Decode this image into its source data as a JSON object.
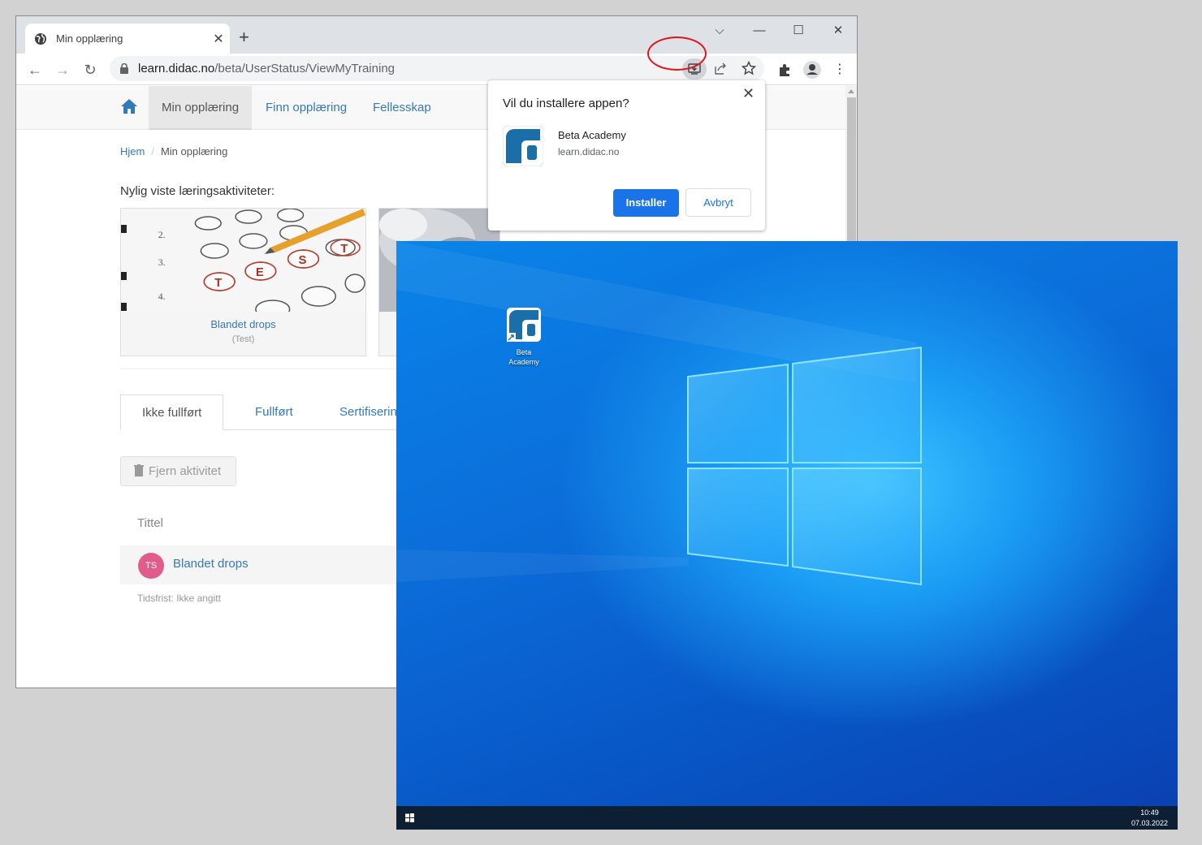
{
  "browser": {
    "tab_title": "Min opplæring",
    "url_host": "learn.didac.no",
    "url_path": "/beta/UserStatus/ViewMyTraining"
  },
  "site": {
    "nav": [
      {
        "label": "Min opplæring"
      },
      {
        "label": "Finn opplæring"
      },
      {
        "label": "Fellesskap"
      }
    ],
    "breadcrumb": {
      "home": "Hjem",
      "current": "Min opplæring"
    },
    "recent_heading": "Nylig viste læringsaktiviteter:",
    "cards": [
      {
        "title": "Blandet drops",
        "subtitle": "(Test)"
      }
    ],
    "tabs": [
      {
        "label": "Ikke fullført"
      },
      {
        "label": "Fullført"
      },
      {
        "label": "Sertifiserin"
      }
    ],
    "remove_label": "Fjern aktivitet",
    "table_header": "Tittel",
    "row": {
      "avatar": "TS",
      "title": "Blandet drops"
    },
    "deadline": "Tidsfrist: Ikke angitt"
  },
  "popup": {
    "title": "Vil du installere appen?",
    "app_name": "Beta Academy",
    "app_url": "learn.didac.no",
    "install": "Installer",
    "cancel": "Avbryt"
  },
  "desktop": {
    "icon_label_1": "Beta",
    "icon_label_2": "Academy",
    "time": "10:49",
    "date": "07.03.2022"
  },
  "colors": {
    "link": "#337ab7",
    "chrome_blue": "#1a73e8",
    "highlight_ring": "#e0161a",
    "app_icon": "#1b6fa8"
  },
  "icons": [
    "globe-icon",
    "close-icon",
    "plus-icon",
    "back-icon",
    "forward-icon",
    "reload-icon",
    "lock-icon",
    "install-app-icon",
    "share-icon",
    "star-icon",
    "extensions-icon",
    "profile-icon",
    "kebab-menu-icon",
    "home-icon",
    "trash-icon",
    "windows-start-icon"
  ]
}
